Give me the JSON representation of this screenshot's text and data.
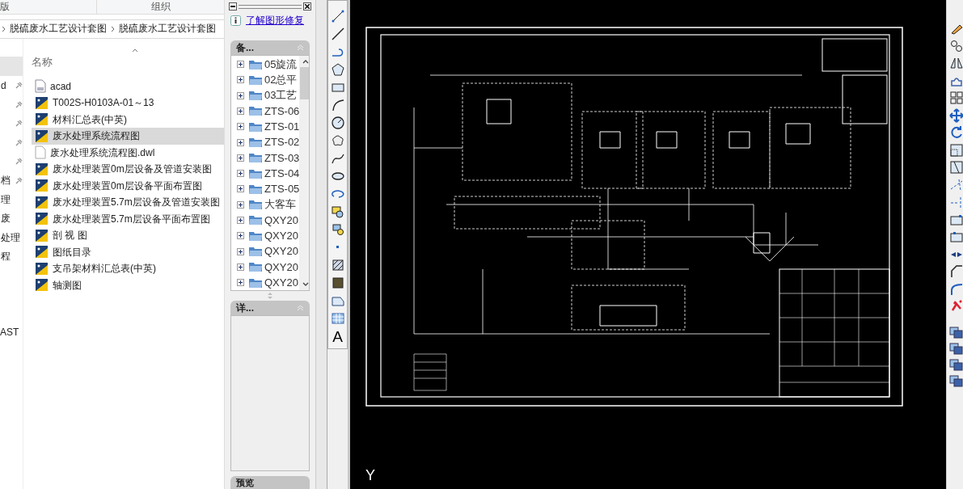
{
  "explorer": {
    "ribbon": [
      "版",
      "组织"
    ],
    "breadcrumb": [
      "脱硫废水工艺设计套图",
      "脱硫废水工艺设计套图"
    ],
    "nav_items": [
      {
        "label": "d",
        "pinned": true
      },
      {
        "pinned": true
      },
      {
        "pinned": true
      },
      {
        "pinned": true
      },
      {
        "pinned": true
      },
      {
        "label": "档",
        "pinned": true
      },
      {
        "label": "理",
        "pinned": false
      },
      {
        "label": "废",
        "pinned": false
      },
      {
        "label": "处理",
        "pinned": false
      },
      {
        "label": "程",
        "pinned": false
      }
    ],
    "nav_bottom": "AST",
    "column_header": "名称",
    "files": [
      {
        "name": "acad",
        "kind": "fas",
        "selected": false
      },
      {
        "name": "T002S-H0103A-01～13",
        "kind": "cad",
        "selected": false
      },
      {
        "name": "材料汇总表(中英)",
        "kind": "cad",
        "selected": false
      },
      {
        "name": "废水处理系统流程图",
        "kind": "cad",
        "selected": true
      },
      {
        "name": "废水处理系统流程图.dwl",
        "kind": "file",
        "selected": false
      },
      {
        "name": "废水处理装置0m层设备及管道安装图",
        "kind": "cad",
        "selected": false
      },
      {
        "name": "废水处理装置0m层设备平面布置图",
        "kind": "cad",
        "selected": false
      },
      {
        "name": "废水处理装置5.7m层设备及管道安装图",
        "kind": "cad",
        "selected": false
      },
      {
        "name": "废水处理装置5.7m层设备平面布置图",
        "kind": "cad",
        "selected": false
      },
      {
        "name": "剖 视 图",
        "kind": "cad",
        "selected": false
      },
      {
        "name": "图纸目录",
        "kind": "cad",
        "selected": false
      },
      {
        "name": "支吊架材料汇总表(中英)",
        "kind": "cad",
        "selected": false
      },
      {
        "name": "轴测图",
        "kind": "cad",
        "selected": false
      }
    ]
  },
  "recovery_panel": {
    "link": "了解图形修复",
    "backup_section": {
      "title": "备...",
      "items": [
        "05旋流",
        "02总平",
        "03工艺",
        "ZTS-06",
        "ZTS-01",
        "ZTS-02",
        "ZTS-03",
        "ZTS-04",
        "ZTS-05",
        "大客车",
        "QXY20",
        "QXY20",
        "QXY20",
        "QXY20",
        "QXY20"
      ]
    },
    "details_section": {
      "title": "详..."
    },
    "preview_section": {
      "title": "预览"
    }
  },
  "draw_toolbar": {
    "text_tool": "A"
  },
  "canvas": {
    "ucs_label": "Y"
  }
}
